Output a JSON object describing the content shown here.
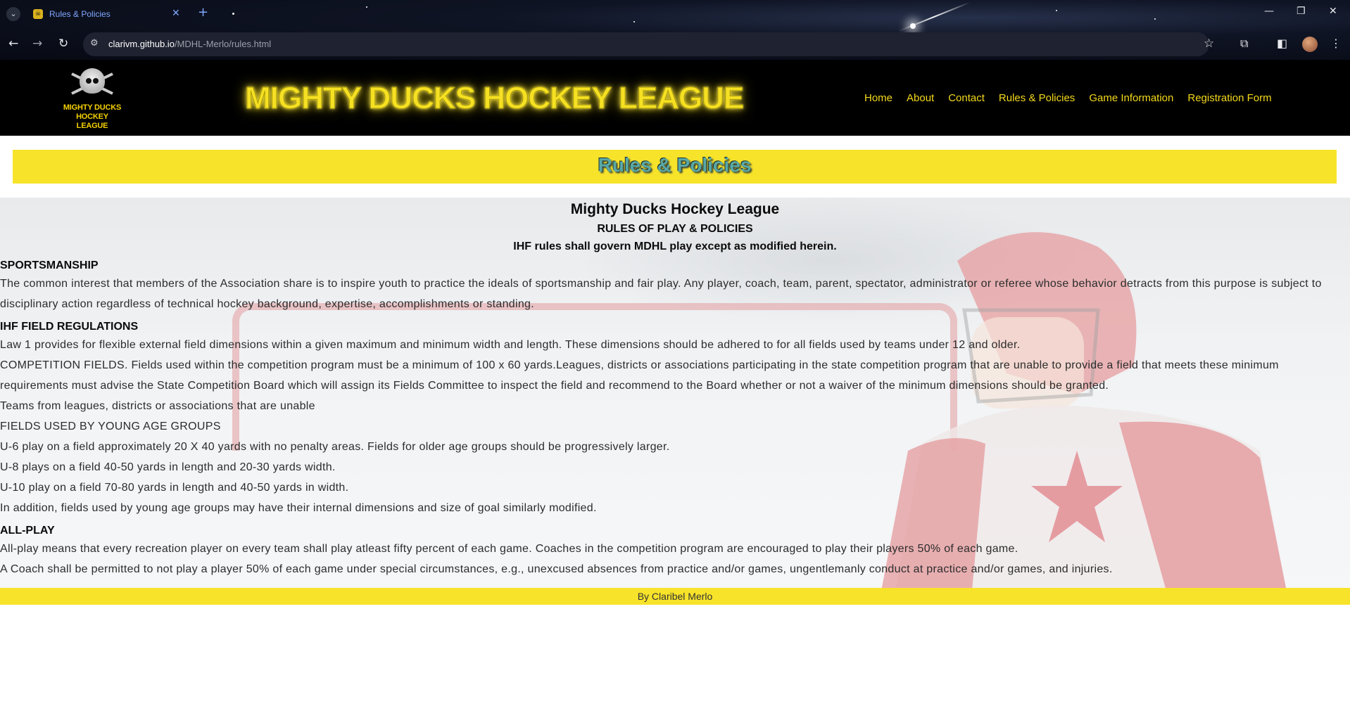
{
  "browser": {
    "tab_title": "Rules & Policies",
    "url_host": "clarivm.github.io",
    "url_path": "/MDHL-Merlo/rules.html"
  },
  "site": {
    "logo_text_line1": "MIGHTY DUCKS",
    "logo_text_line2": "HOCKEY LEAGUE",
    "title": "MIGHTY DUCKS HOCKEY LEAGUE",
    "nav": [
      "Home",
      "About",
      "Contact",
      "Rules & Policies",
      "Game Information",
      "Registration Form"
    ]
  },
  "banner": {
    "title": "Rules & Policies"
  },
  "content": {
    "title": "Mighty Ducks Hockey League",
    "subtitle": "RULES OF PLAY & POLICIES",
    "subtitle2": "IHF rules shall govern MDHL play except as modified herein.",
    "sections": [
      {
        "heading": "SPORTSMANSHIP",
        "paragraphs": [
          "The common interest that members of the Association share is to inspire youth to practice the ideals of sportsmanship and fair play. Any player, coach, team, parent, spectator, administrator or referee whose behavior detracts from this purpose is subject to disciplinary action regardless of technical hockey background, expertise, accomplishments or standing."
        ]
      },
      {
        "heading": "IHF FIELD REGULATIONS",
        "paragraphs": [
          "Law 1 provides for flexible external field dimensions within a given maximum and minimum width and length. These dimensions should be adhered to for all fields used by teams under 12 and older.",
          "COMPETITION FIELDS. Fields used within the competition program must be a minimum of 100 x 60 yards.Leagues, districts or associations participating in the state competition program that are unable to provide a field that meets these minimum requirements must advise the State Competition Board which will assign its Fields Committee to inspect the field and recommend to the Board whether or not a waiver of the minimum dimensions should be granted.",
          "Teams from leagues, districts or associations that are unable",
          "FIELDS USED BY YOUNG AGE GROUPS",
          "U-6 play on a field approximately 20 X 40 yards with no penalty areas. Fields for older age groups should be progressively larger.",
          "U-8 plays on a field 40-50 yards in length and 20-30 yards width.",
          "U-10 play on a field 70-80 yards in length and 40-50 yards in width.",
          "In addition, fields used by young age groups may have their internal dimensions and size of goal similarly modified."
        ]
      },
      {
        "heading": "ALL-PLAY",
        "paragraphs": [
          "All-play means that every recreation player on every team shall play atleast fifty percent of each game. Coaches in the competition program are encouraged to play their players 50% of each game.",
          "A Coach shall be permitted to not play a player 50% of each game under special circumstances, e.g., unexcused absences from practice and/or games, ungentlemanly conduct at practice and/or games, and injuries."
        ]
      }
    ]
  },
  "footer": {
    "text": "By Claribel Merlo"
  }
}
